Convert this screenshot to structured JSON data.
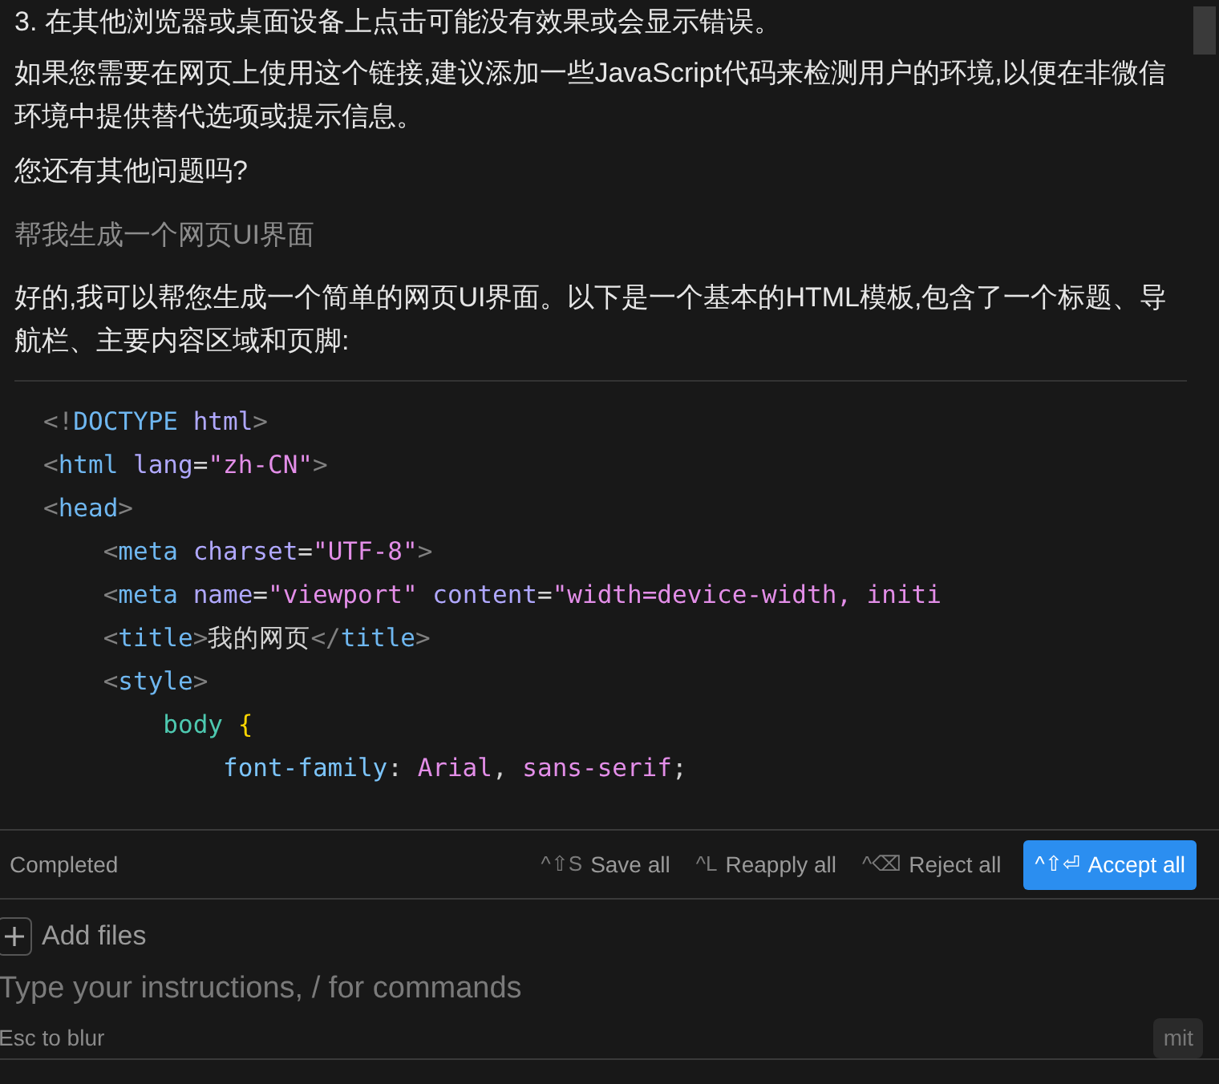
{
  "messages": [
    {
      "kind": "assistant",
      "text": "3. 在其他浏览器或桌面设备上点击可能没有效果或会显示错误。"
    },
    {
      "kind": "assistant",
      "text": "如果您需要在网页上使用这个链接,建议添加一些JavaScript代码来检测用户的环境,以便在非微信环境中提供替代选项或提示信息。"
    },
    {
      "kind": "assistant",
      "text": "您还有其他问题吗?"
    },
    {
      "kind": "user",
      "text": "帮我生成一个网页UI界面"
    },
    {
      "kind": "assistant",
      "text": "好的,我可以帮您生成一个简单的网页UI界面。以下是一个基本的HTML模板,包含了一个标题、导航栏、主要内容区域和页脚:"
    }
  ],
  "code": [
    [
      {
        "t": "<!",
        "kind": "punct"
      },
      {
        "t": "DOCTYPE",
        "kind": "tag"
      },
      {
        "t": " html",
        "kind": "attr"
      },
      {
        "t": ">",
        "kind": "punct"
      }
    ],
    [
      {
        "t": "<",
        "kind": "punct"
      },
      {
        "t": "html",
        "kind": "tag"
      },
      {
        "t": " lang",
        "kind": "attr"
      },
      {
        "t": "=",
        "kind": "plain"
      },
      {
        "t": "\"zh-CN\"",
        "kind": "string"
      },
      {
        "t": ">",
        "kind": "punct"
      }
    ],
    [
      {
        "t": "<",
        "kind": "punct"
      },
      {
        "t": "head",
        "kind": "tag"
      },
      {
        "t": ">",
        "kind": "punct"
      }
    ],
    [
      {
        "t": "    <",
        "kind": "punct"
      },
      {
        "t": "meta",
        "kind": "tag"
      },
      {
        "t": " charset",
        "kind": "attr"
      },
      {
        "t": "=",
        "kind": "plain"
      },
      {
        "t": "\"UTF-8\"",
        "kind": "string"
      },
      {
        "t": ">",
        "kind": "punct"
      }
    ],
    [
      {
        "t": "    <",
        "kind": "punct"
      },
      {
        "t": "meta",
        "kind": "tag"
      },
      {
        "t": " name",
        "kind": "attr"
      },
      {
        "t": "=",
        "kind": "plain"
      },
      {
        "t": "\"viewport\"",
        "kind": "string"
      },
      {
        "t": " content",
        "kind": "attr"
      },
      {
        "t": "=",
        "kind": "plain"
      },
      {
        "t": "\"width=device-width, initi",
        "kind": "string"
      }
    ],
    [
      {
        "t": "    <",
        "kind": "punct"
      },
      {
        "t": "title",
        "kind": "tag"
      },
      {
        "t": ">",
        "kind": "punct"
      },
      {
        "t": "我的网页",
        "kind": "plain"
      },
      {
        "t": "</",
        "kind": "punct"
      },
      {
        "t": "title",
        "kind": "tag"
      },
      {
        "t": ">",
        "kind": "punct"
      }
    ],
    [
      {
        "t": "    <",
        "kind": "punct"
      },
      {
        "t": "style",
        "kind": "tag"
      },
      {
        "t": ">",
        "kind": "punct"
      }
    ],
    [
      {
        "t": "        body",
        "kind": "selector"
      },
      {
        "t": " {",
        "kind": "brace"
      }
    ],
    [
      {
        "t": "            font-family",
        "kind": "property"
      },
      {
        "t": ": ",
        "kind": "plain"
      },
      {
        "t": "Arial",
        "kind": "string"
      },
      {
        "t": ", ",
        "kind": "plain"
      },
      {
        "t": "sans-serif",
        "kind": "string"
      },
      {
        "t": ";",
        "kind": "plain"
      }
    ]
  ],
  "status": "Completed",
  "actions": [
    {
      "shortcut": "^⇧S",
      "label": "Save all",
      "primary": false
    },
    {
      "shortcut": "^L",
      "label": "Reapply all",
      "primary": false
    },
    {
      "shortcut": "^⌫",
      "label": "Reject all",
      "primary": false
    },
    {
      "shortcut": "^⇧⏎",
      "label": "Accept all",
      "primary": true
    }
  ],
  "add_files": "Add files",
  "input": {
    "placeholder": "Type your instructions, / for commands"
  },
  "hint": "Esc to blur",
  "submit": "mit"
}
